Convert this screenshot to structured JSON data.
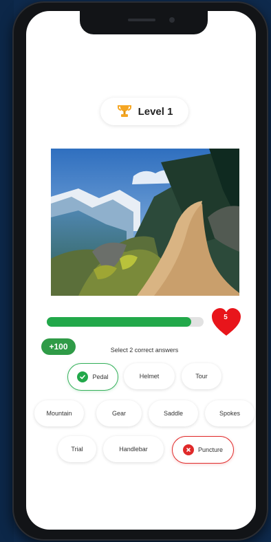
{
  "level": {
    "label": "Level 1",
    "icon": "trophy-icon"
  },
  "progress": {
    "value": 0.92,
    "color": "#22a84a"
  },
  "lives": {
    "count": "5",
    "color": "#e8151b"
  },
  "score_badge": "+100",
  "instruction": "Select 2 correct answers",
  "answers": [
    {
      "label": "Pedal",
      "state": "correct"
    },
    {
      "label": "Helmet",
      "state": "neutral"
    },
    {
      "label": "Tour",
      "state": "neutral"
    },
    {
      "label": "Mountain",
      "state": "neutral"
    },
    {
      "label": "Gear",
      "state": "neutral"
    },
    {
      "label": "Saddle",
      "state": "neutral"
    },
    {
      "label": "Spokes",
      "state": "neutral"
    },
    {
      "label": "Trial",
      "state": "neutral"
    },
    {
      "label": "Handlebar",
      "state": "neutral"
    },
    {
      "label": "Puncture",
      "state": "wrong"
    }
  ]
}
